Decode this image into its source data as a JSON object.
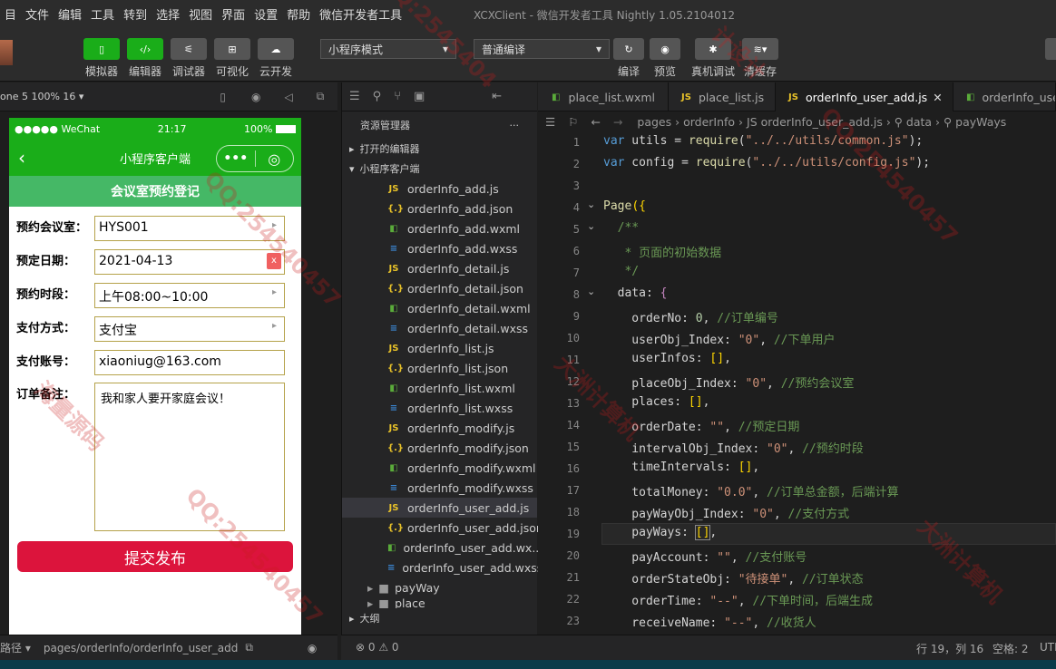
{
  "menubar": {
    "items": [
      "目",
      "文件",
      "编辑",
      "工具",
      "转到",
      "选择",
      "视图",
      "界面",
      "设置",
      "帮助",
      "微信开发者工具"
    ],
    "title": "XCXClient - 微信开发者工具 Nightly 1.05.2104012"
  },
  "toolbar": {
    "buttons": [
      {
        "label": "模拟器",
        "icon": "phone-icon"
      },
      {
        "label": "编辑器",
        "icon": "code-icon"
      },
      {
        "label": "调试器",
        "icon": "debug-icon"
      },
      {
        "label": "可视化",
        "icon": "layout-icon"
      },
      {
        "label": "云开发",
        "icon": "cloud-icon"
      }
    ],
    "mode_select": "小程序模式",
    "compile_select": "普通编译",
    "right_buttons": [
      {
        "label": "编译",
        "icon": "refresh-icon"
      },
      {
        "label": "预览",
        "icon": "eye-icon"
      },
      {
        "label": "真机调试",
        "icon": "bug-icon"
      },
      {
        "label": "清缓存",
        "icon": "layers-icon"
      }
    ]
  },
  "simulator": {
    "device": "one 5 100% 16 ▾",
    "status": {
      "left": "●●●●● WeChat",
      "time": "21:17",
      "battery": "100%"
    },
    "nav_title": "小程序客户端",
    "banner": "会议室预约登记",
    "form": [
      {
        "label": "预约会议室：",
        "value": "HYS001",
        "type": "picker"
      },
      {
        "label": "预定日期：",
        "value": "2021-04-13",
        "type": "date"
      },
      {
        "label": "预约时段：",
        "value": "上午08:00~10:00",
        "type": "picker"
      },
      {
        "label": "支付方式：",
        "value": "支付宝",
        "type": "picker"
      },
      {
        "label": "支付账号：",
        "value": "xiaoniug@163.com",
        "type": "input"
      }
    ],
    "remark_label": "订单备注：",
    "remark_value": "我和家人要开家庭会议！",
    "date_clear": "x",
    "submit": "提交发布",
    "footer": {
      "left": "路径 ▾",
      "path": "pages/orderInfo/orderInfo_user_add"
    }
  },
  "explorer": {
    "title": "资源管理器",
    "more": "···",
    "open_editors": "打开的编辑器",
    "project": "小程序客户端",
    "files": [
      {
        "name": "orderInfo_add.js",
        "type": "js"
      },
      {
        "name": "orderInfo_add.json",
        "type": "json"
      },
      {
        "name": "orderInfo_add.wxml",
        "type": "wxml"
      },
      {
        "name": "orderInfo_add.wxss",
        "type": "wxss"
      },
      {
        "name": "orderInfo_detail.js",
        "type": "js"
      },
      {
        "name": "orderInfo_detail.json",
        "type": "json"
      },
      {
        "name": "orderInfo_detail.wxml",
        "type": "wxml"
      },
      {
        "name": "orderInfo_detail.wxss",
        "type": "wxss"
      },
      {
        "name": "orderInfo_list.js",
        "type": "js"
      },
      {
        "name": "orderInfo_list.json",
        "type": "json"
      },
      {
        "name": "orderInfo_list.wxml",
        "type": "wxml"
      },
      {
        "name": "orderInfo_list.wxss",
        "type": "wxss"
      },
      {
        "name": "orderInfo_modify.js",
        "type": "js"
      },
      {
        "name": "orderInfo_modify.json",
        "type": "json"
      },
      {
        "name": "orderInfo_modify.wxml",
        "type": "wxml"
      },
      {
        "name": "orderInfo_modify.wxss",
        "type": "wxss"
      },
      {
        "name": "orderInfo_user_add.js",
        "type": "js"
      },
      {
        "name": "orderInfo_user_add.json",
        "type": "json"
      },
      {
        "name": "orderInfo_user_add.wx...",
        "type": "wxml"
      },
      {
        "name": "orderInfo_user_add.wxss",
        "type": "wxss"
      }
    ],
    "folders": [
      "payWay",
      "place"
    ],
    "outline": "大纲"
  },
  "editor": {
    "tabs": [
      "place_list.wxml",
      "place_list.js",
      "orderInfo_user_add.js",
      "orderInfo_use"
    ],
    "breadcrumb": "pages › orderInfo › JS orderInfo_user_add.js › ⚲ data › ⚲ payWays",
    "lines": [
      "1",
      "2",
      "3",
      "4",
      "5",
      "6",
      "7",
      "8",
      "9",
      "10",
      "11",
      "12",
      "13",
      "14",
      "15",
      "16",
      "17",
      "18",
      "19",
      "20",
      "21",
      "22",
      "23"
    ]
  },
  "statusbar": {
    "errors": "⊗ 0 ⚠ 0",
    "position": "行 19，列 16",
    "spaces": "空格: 2",
    "encoding": "UTF"
  },
  "watermarks": [
    "QQ:2545404",
    "计设计",
    "大洲计算机",
    "QQ:254540457",
    "海量源码"
  ]
}
